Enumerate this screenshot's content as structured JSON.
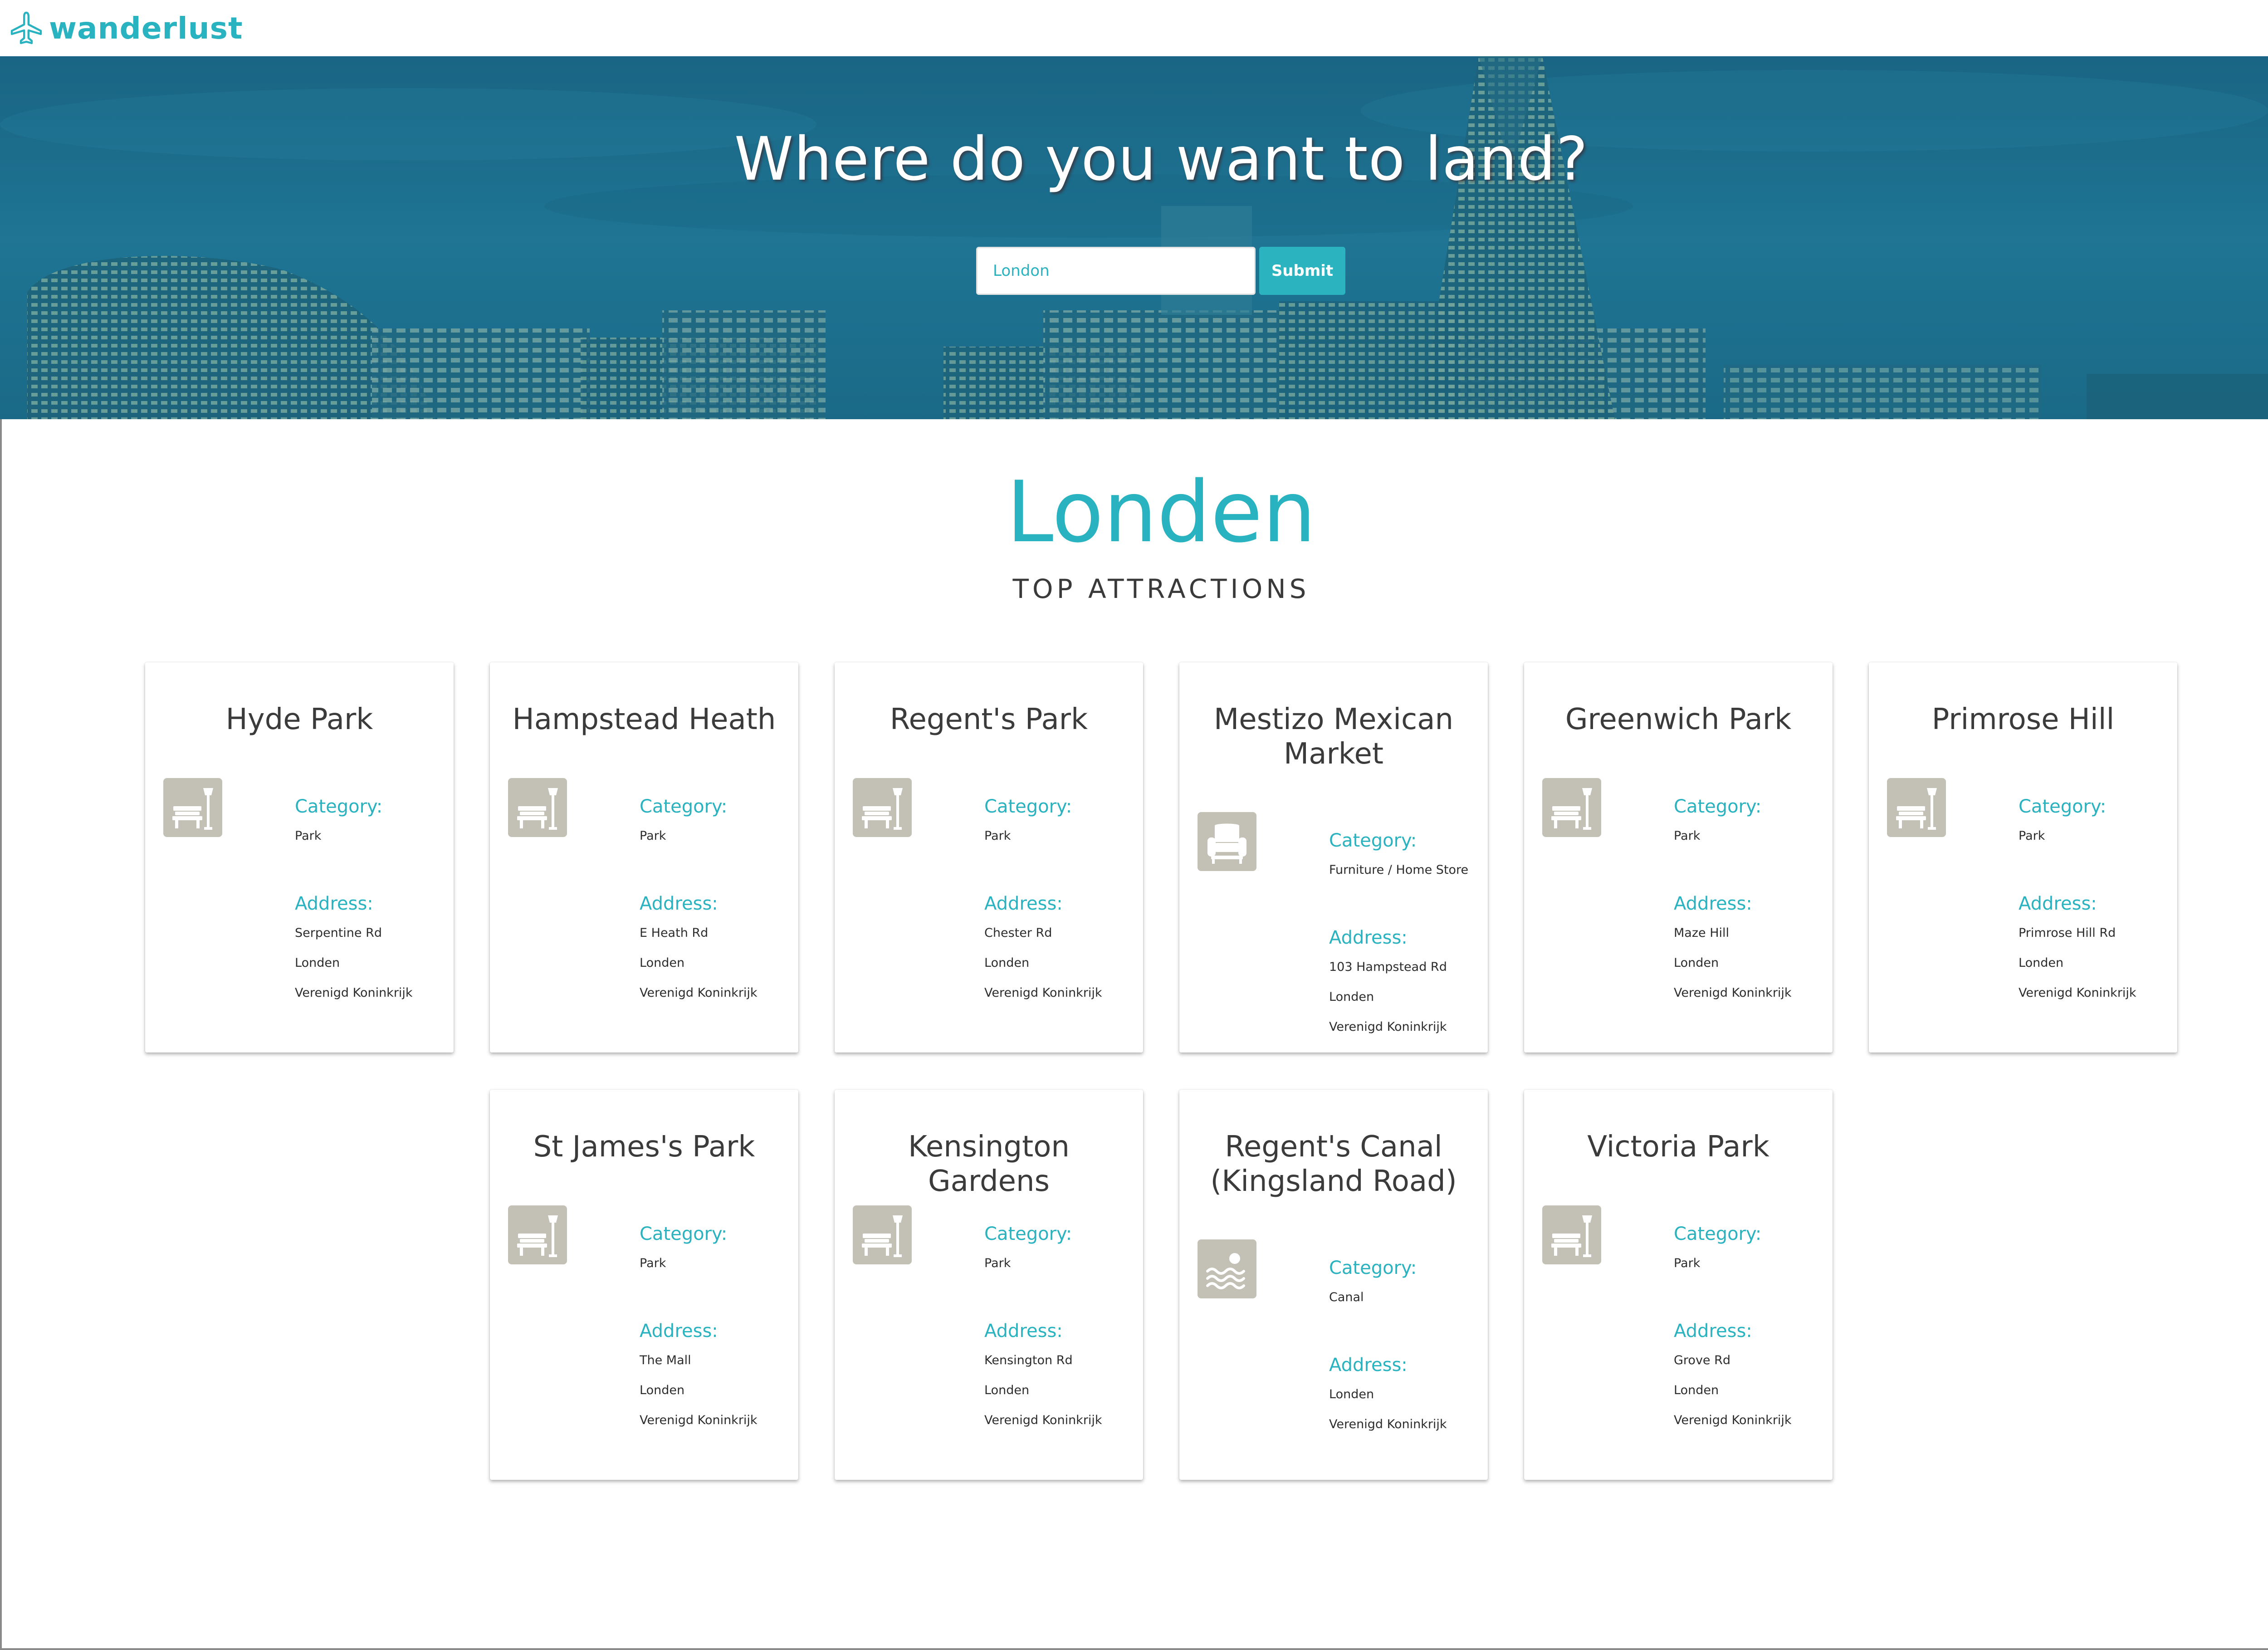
{
  "app": {
    "brand": "wanderlust",
    "brand_color": "#29b2bf"
  },
  "hero": {
    "title": "Where do you want to land?",
    "search": {
      "value": "London",
      "placeholder": ""
    },
    "submit_label": "Submit"
  },
  "results": {
    "city": "Londen",
    "subtitle": "TOP ATTRACTIONS",
    "category_label": "Category:",
    "address_label": "Address:",
    "attractions": [
      {
        "name": "Hyde Park",
        "icon": "park-bench-icon",
        "category": "Park",
        "address": [
          "Serpentine Rd",
          "Londen",
          "Verenigd Koninkrijk"
        ]
      },
      {
        "name": "Hampstead Heath",
        "icon": "park-bench-icon",
        "category": "Park",
        "address": [
          "E Heath Rd",
          "Londen",
          "Verenigd Koninkrijk"
        ]
      },
      {
        "name": "Regent's Park",
        "icon": "park-bench-icon",
        "category": "Park",
        "address": [
          "Chester Rd",
          "Londen",
          "Verenigd Koninkrijk"
        ]
      },
      {
        "name": "Mestizo Mexican Market",
        "icon": "armchair-icon",
        "category": "Furniture / Home Store",
        "address": [
          "103 Hampstead Rd",
          "Londen",
          "Verenigd Koninkrijk"
        ]
      },
      {
        "name": "Greenwich Park",
        "icon": "park-bench-icon",
        "category": "Park",
        "address": [
          "Maze Hill",
          "Londen",
          "Verenigd Koninkrijk"
        ]
      },
      {
        "name": "Primrose Hill",
        "icon": "park-bench-icon",
        "category": "Park",
        "address": [
          "Primrose Hill Rd",
          "Londen",
          "Verenigd Koninkrijk"
        ]
      },
      {
        "name": "St James's Park",
        "icon": "park-bench-icon",
        "category": "Park",
        "address": [
          "The Mall",
          "Londen",
          "Verenigd Koninkrijk"
        ]
      },
      {
        "name": "Kensington Gardens",
        "icon": "park-bench-icon",
        "category": "Park",
        "address": [
          "Kensington Rd",
          "Londen",
          "Verenigd Koninkrijk"
        ]
      },
      {
        "name": "Regent's Canal (Kingsland Road)",
        "icon": "waves-icon",
        "category": "Canal",
        "address": [
          "Londen",
          "Verenigd Koninkrijk"
        ]
      },
      {
        "name": "Victoria Park",
        "icon": "park-bench-icon",
        "category": "Park",
        "address": [
          "Grove Rd",
          "Londen",
          "Verenigd Koninkrijk"
        ]
      }
    ]
  }
}
